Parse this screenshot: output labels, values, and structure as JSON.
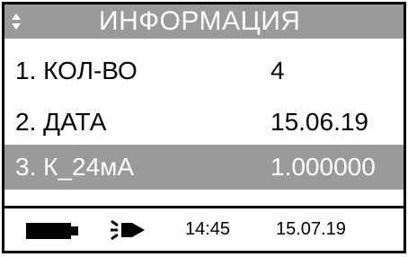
{
  "header": {
    "title": "ИНФОРМАЦИЯ",
    "scroll_icon": "up-down-arrows-icon"
  },
  "menu": {
    "items": [
      {
        "label": "1. КОЛ-ВО",
        "value": "4",
        "selected": false
      },
      {
        "label": "2. ДАТА",
        "value": "15.06.19",
        "selected": false
      },
      {
        "label": "3. К_24мА",
        "value": "1.000000",
        "selected": true
      }
    ]
  },
  "status": {
    "battery_icon": "battery-icon",
    "power_icon": "power-plug-icon",
    "time": "14:45",
    "date": "15.07.19"
  },
  "colors": {
    "highlight": "#9a9a9a",
    "highlight_text": "#ffffff",
    "text": "#000000"
  }
}
